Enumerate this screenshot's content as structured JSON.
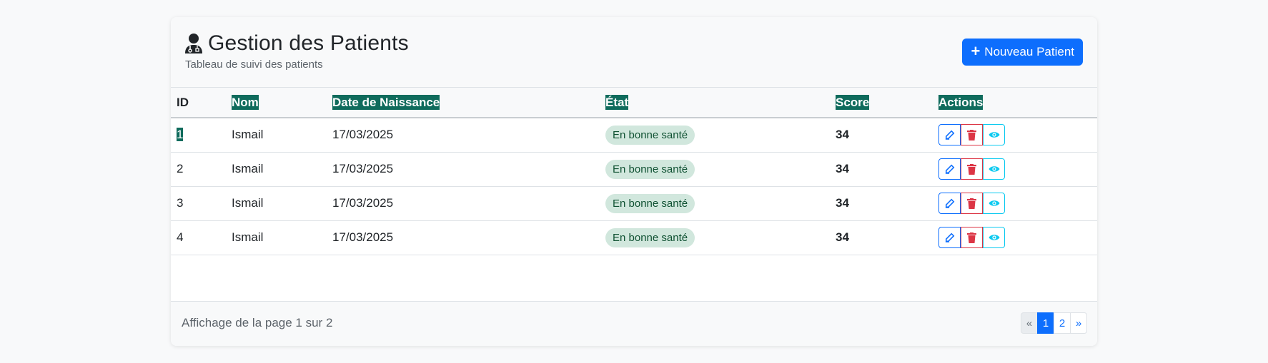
{
  "header": {
    "title": "Gestion des Patients",
    "subtitle": "Tableau de suivi des patients",
    "new_button_label": "Nouveau Patient",
    "new_button_icon": "+"
  },
  "table": {
    "columns": [
      "ID",
      "Nom",
      "Date de Naissance",
      "État",
      "Score",
      "Actions"
    ],
    "rows": [
      {
        "id": "1",
        "name": "Ismail",
        "birthdate": "17/03/2025",
        "state": "En bonne santé",
        "score": "34"
      },
      {
        "id": "2",
        "name": "Ismail",
        "birthdate": "17/03/2025",
        "state": "En bonne santé",
        "score": "34"
      },
      {
        "id": "3",
        "name": "Ismail",
        "birthdate": "17/03/2025",
        "state": "En bonne santé",
        "score": "34"
      },
      {
        "id": "4",
        "name": "Ismail",
        "birthdate": "17/03/2025",
        "state": "En bonne santé",
        "score": "34"
      }
    ]
  },
  "footer": {
    "page_info": "Affichage de la page 1 sur 2",
    "pagination": {
      "prev": "«",
      "pages": [
        "1",
        "2"
      ],
      "next": "»",
      "current": "1"
    }
  },
  "colors": {
    "primary": "#0d6efd",
    "danger": "#dc3545",
    "info": "#0dcaf0",
    "selection_highlight": "#0f6b5c",
    "badge_bg": "#d1e7dd",
    "badge_text": "#0f5132"
  },
  "icons": {
    "title": "user-doctor-icon",
    "edit": "edit-icon",
    "delete": "trash-icon",
    "view": "eye-icon"
  }
}
